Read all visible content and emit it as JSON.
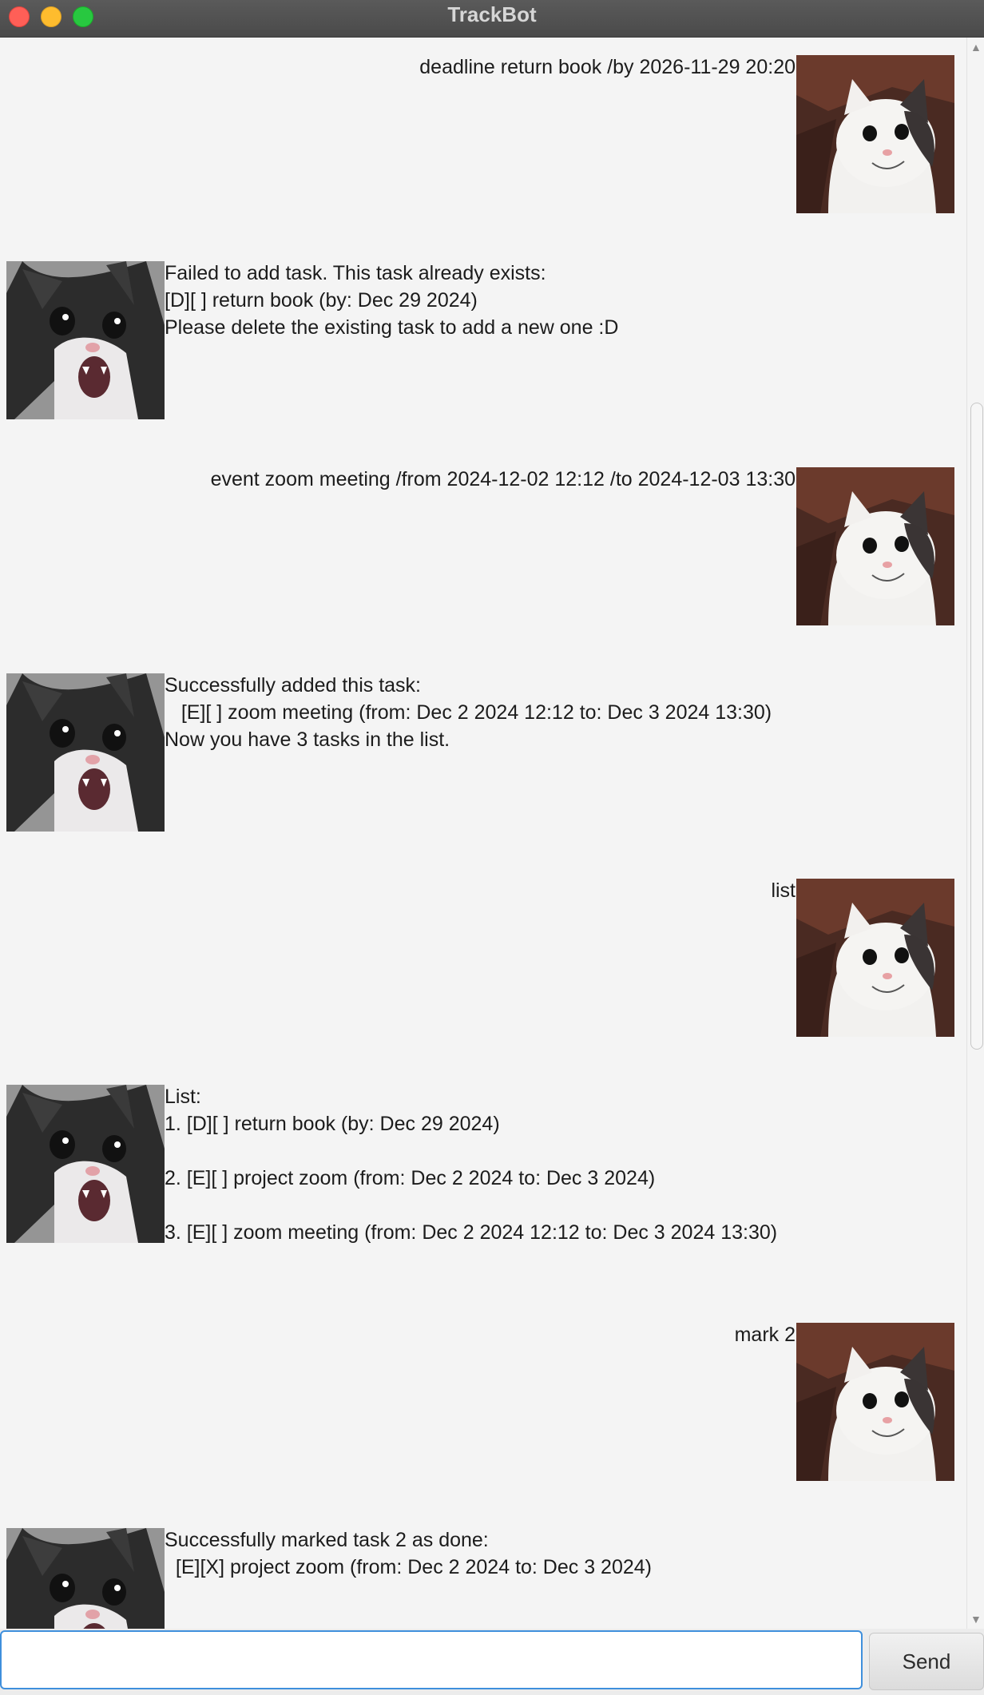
{
  "window": {
    "title": "TrackBot"
  },
  "messages": [
    {
      "role": "user",
      "text": "deadline return book /by 2026-11-29 20:20"
    },
    {
      "role": "bot",
      "text": "Failed to add task. This task already exists:\n[D][ ] return book (by: Dec 29 2024)\nPlease delete the existing task to add a new one :D"
    },
    {
      "role": "user",
      "text": "event zoom meeting /from 2024-12-02 12:12 /to 2024-12-03 13:30"
    },
    {
      "role": "bot",
      "text": "Successfully added this task:\n   [E][ ] zoom meeting (from: Dec 2 2024 12:12 to: Dec 3 2024 13:30)\nNow you have 3 tasks in the list."
    },
    {
      "role": "user",
      "text": "list"
    },
    {
      "role": "bot",
      "text": "List:\n1. [D][ ] return book (by: Dec 29 2024)\n\n2. [E][ ] project zoom (from: Dec 2 2024 to: Dec 3 2024)\n\n3. [E][ ] zoom meeting (from: Dec 2 2024 12:12 to: Dec 3 2024 13:30)"
    },
    {
      "role": "user",
      "text": "mark 2"
    },
    {
      "role": "bot",
      "text": "Successfully marked task 2 as done:\n  [E][X] project zoom (from: Dec 2 2024 to: Dec 3 2024)"
    }
  ],
  "input": {
    "value": "",
    "send_label": "Send"
  }
}
